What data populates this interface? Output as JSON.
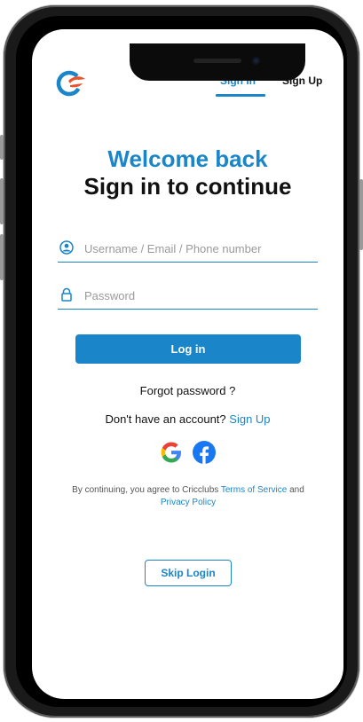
{
  "header": {
    "tabs": {
      "signin": "Sign In",
      "signup": "Sign Up"
    }
  },
  "hero": {
    "welcome": "Welcome back",
    "subtitle": "Sign in to continue"
  },
  "form": {
    "username_placeholder": "Username / Email / Phone number",
    "password_placeholder": "Password",
    "login_label": "Log in"
  },
  "links": {
    "forgot": "Forgot password ?",
    "no_account_text": "Don't have an account?",
    "signup_link": "Sign Up"
  },
  "social": {
    "google_icon": "google-icon",
    "facebook_icon": "facebook-icon"
  },
  "terms": {
    "prefix": "By continuing, you agree to Cricclubs",
    "tos": "Terms of Service",
    "and": "and",
    "privacy": "Privacy Policy"
  },
  "skip": {
    "label": "Skip Login"
  },
  "colors": {
    "primary": "#1a86c9",
    "text": "#111111"
  }
}
